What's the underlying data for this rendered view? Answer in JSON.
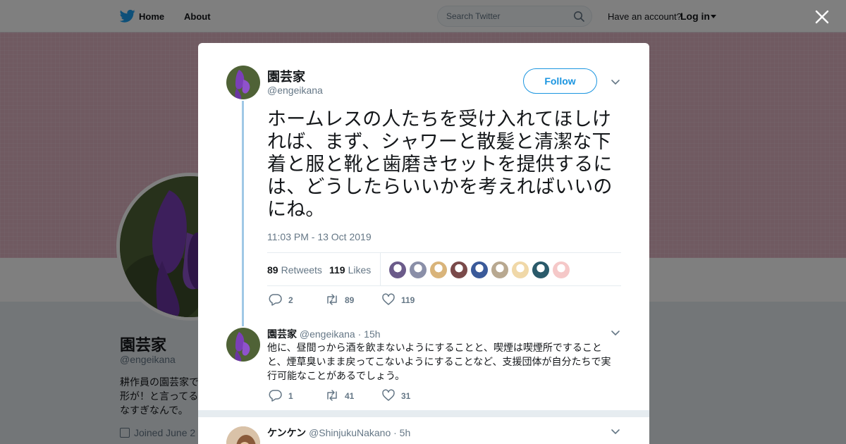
{
  "nav": {
    "home_label": "Home",
    "about_label": "About",
    "search_placeholder": "Search Twitter",
    "have_account": "Have an account?",
    "login_label": "Log in"
  },
  "profile": {
    "name": "園芸家",
    "handle": "@engeikana",
    "bio": "耕作員の園芸家で\n形が！と言ってる\nなすぎなんで。",
    "joined": "Joined June 2"
  },
  "tweet": {
    "author_name": "園芸家",
    "author_handle": "@engeikana",
    "follow_label": "Follow",
    "text": "ホームレスの人たちを受け入れてほしければ、まず、シャワーと散髪と清潔な下着と服と靴と歯磨きセットを提供するには、どうしたらいいかを考えればいいのにね。",
    "timestamp": "11:03 PM - 13 Oct 2019",
    "retweets_count": "89",
    "retweets_label": "Retweets",
    "likes_count": "119",
    "likes_label": "Likes",
    "actions": {
      "replies": "2",
      "retweets": "89",
      "likes": "119"
    },
    "liker_avatar_colors": [
      "#6b5b8a",
      "#8a8fa8",
      "#d9b47a",
      "#7a4a4a",
      "#3a5a9a",
      "#b8a890",
      "#f0d8a8",
      "#2a5a6a",
      "#f5c8c8"
    ]
  },
  "reply": {
    "author_name": "園芸家",
    "author_handle": "@engeikana",
    "time": "· 15h",
    "text": "他に、昼間っから酒を飲まないようにすることと、喫煙は喫煙所ですることと、煙草臭いまま戻ってこないようにすることなど、支援団体が自分たちで実行可能なことがあるでしょう。",
    "actions": {
      "replies": "1",
      "retweets": "41",
      "likes": "31"
    }
  },
  "next_reply": {
    "author_name": "ケンケン",
    "author_handle": "@ShinjukuNakano",
    "time": "· 5h"
  },
  "colors": {
    "accent": "#1b95e0",
    "banner": "#e0b4c3",
    "thread_line": "#a0c8e6"
  }
}
